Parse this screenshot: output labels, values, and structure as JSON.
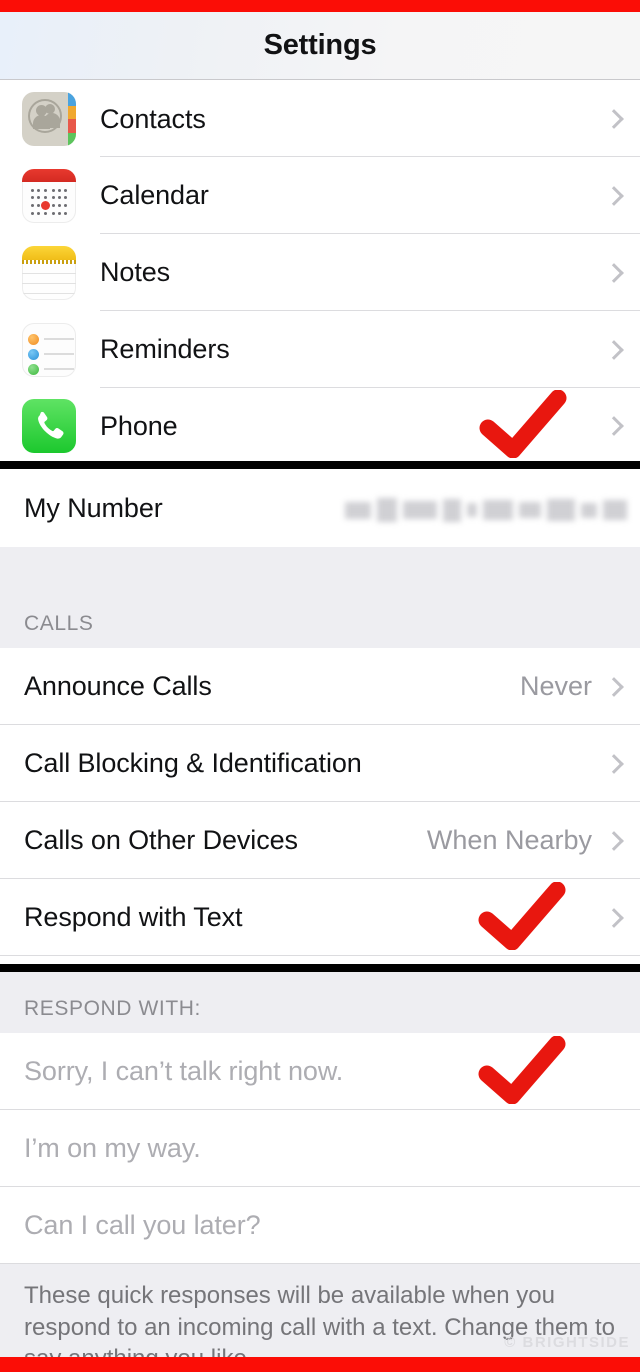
{
  "theme": {
    "frame_red": "#fb0d06",
    "separator_black": "#010101",
    "check_red": "#e8170f",
    "group_bg": "#eeeef2",
    "row_bg": "#ffffff",
    "label_color": "#111214",
    "value_color": "#9a9aa0",
    "placeholder_color": "#adadb2",
    "chevron_color": "#c2c2c7"
  },
  "header": {
    "title": "Settings"
  },
  "apps_section": {
    "rows": [
      {
        "label": "Contacts",
        "icon": "contacts-icon",
        "chevron": true,
        "checked": false
      },
      {
        "label": "Calendar",
        "icon": "calendar-icon",
        "chevron": true,
        "checked": false
      },
      {
        "label": "Notes",
        "icon": "notes-icon",
        "chevron": true,
        "checked": false
      },
      {
        "label": "Reminders",
        "icon": "reminders-icon",
        "chevron": true,
        "checked": false
      },
      {
        "label": "Phone",
        "icon": "phone-icon",
        "chevron": true,
        "checked": true
      }
    ]
  },
  "my_number_section": {
    "label": "My Number",
    "value": "",
    "value_redacted": true
  },
  "calls_section": {
    "header": "CALLS",
    "rows": [
      {
        "label": "Announce Calls",
        "value": "Never",
        "chevron": true,
        "checked": false
      },
      {
        "label": "Call Blocking & Identification",
        "value": "",
        "chevron": true,
        "checked": false
      },
      {
        "label": "Calls on Other Devices",
        "value": "When Nearby",
        "chevron": true,
        "checked": false
      },
      {
        "label": "Respond with Text",
        "value": "",
        "chevron": true,
        "checked": true
      }
    ]
  },
  "respond_with_section": {
    "header": "RESPOND WITH:",
    "rows": [
      {
        "label": "Sorry, I can’t talk right now.",
        "checked": true
      },
      {
        "label": "I’m on my way.",
        "checked": false
      },
      {
        "label": "Can I call you later?",
        "checked": false
      }
    ],
    "footer": "These quick responses will be available when you respond to an incoming call with a text. Change them to say anything you like."
  },
  "watermark": {
    "text": "© BRIGHTSIDE"
  }
}
